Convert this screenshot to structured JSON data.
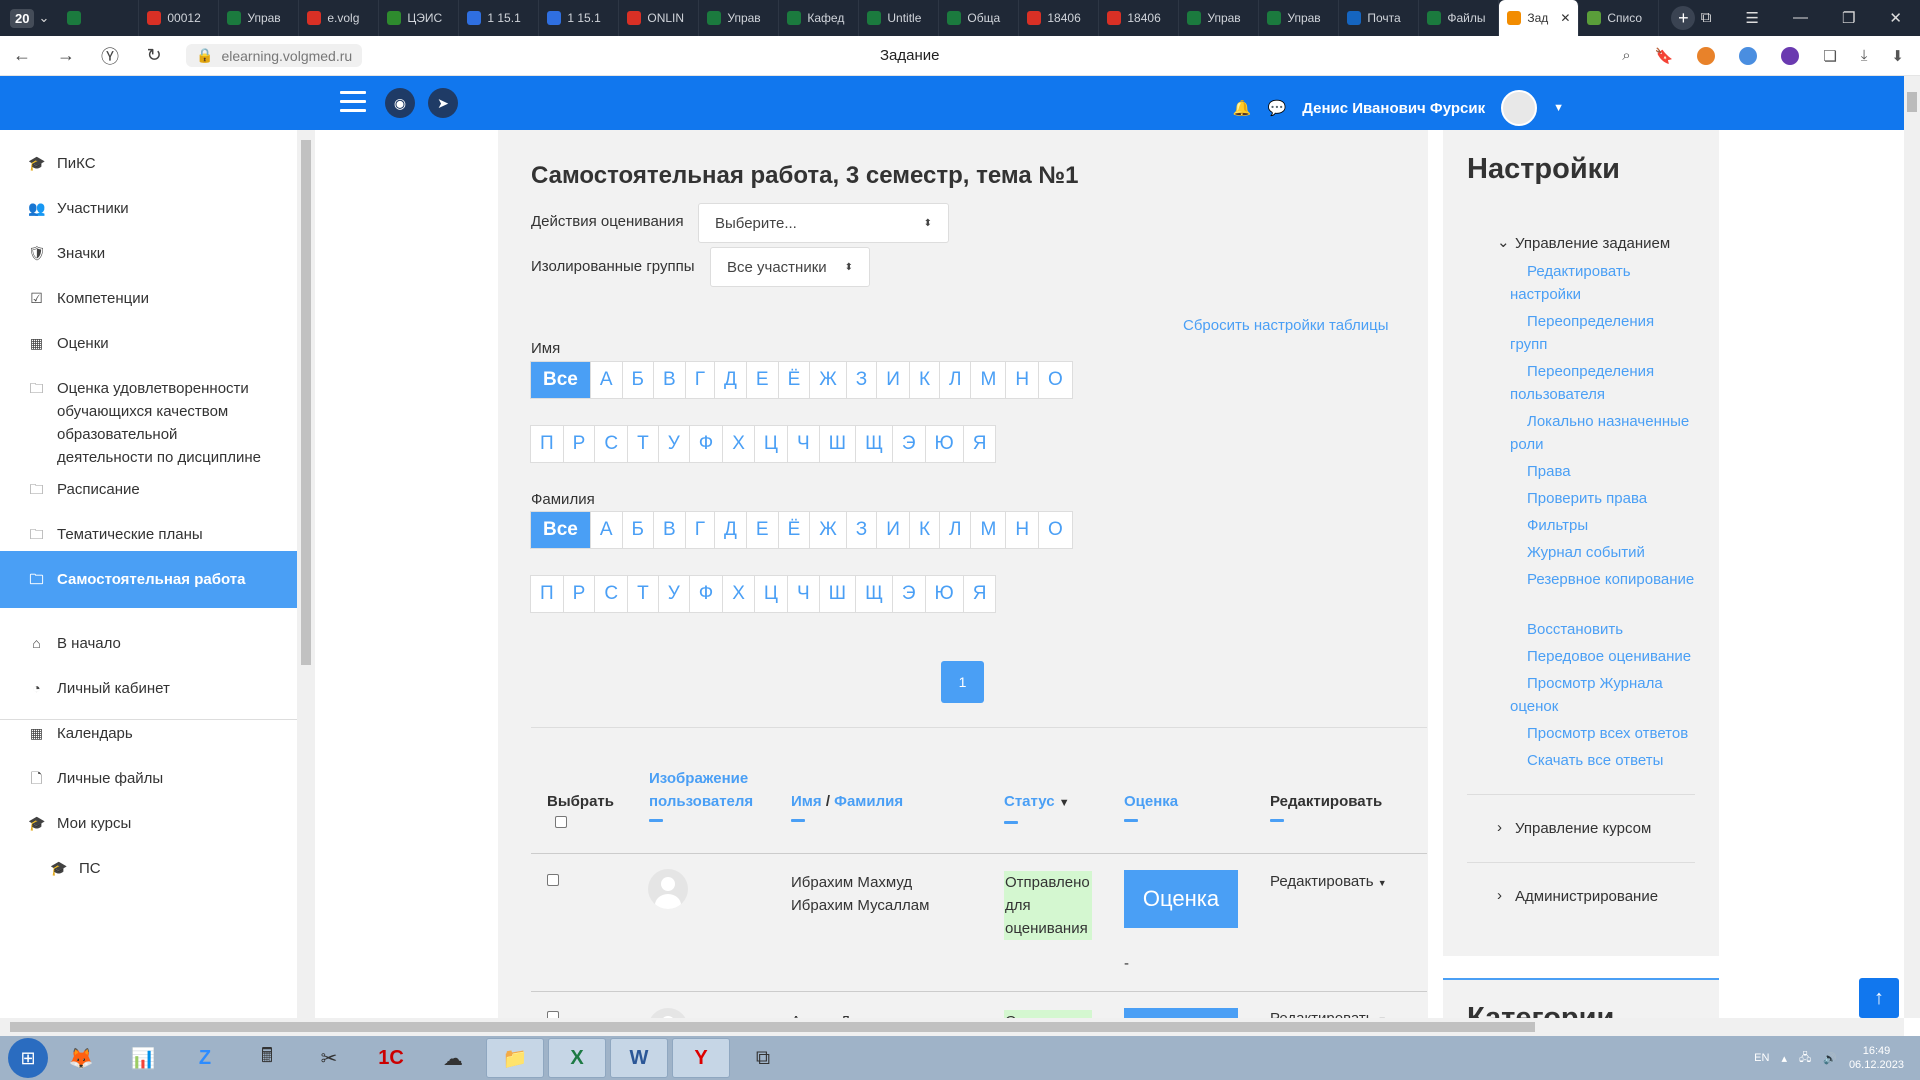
{
  "browser": {
    "tab_count": "20",
    "tabs": [
      {
        "label": "",
        "color": "#1b7a3e"
      },
      {
        "label": "00012",
        "color": "#d93025"
      },
      {
        "label": "Управ",
        "color": "#1b7a3e"
      },
      {
        "label": "e.volg",
        "color": "#d93025"
      },
      {
        "label": "ЦЭИС",
        "color": "#2e8b2e"
      },
      {
        "label": "1 15.1",
        "color": "#2f6fe0"
      },
      {
        "label": "1 15.1",
        "color": "#2f6fe0"
      },
      {
        "label": "ONLIN",
        "color": "#d93025"
      },
      {
        "label": "Управ",
        "color": "#1b7a3e"
      },
      {
        "label": "Кафед",
        "color": "#1b7a3e"
      },
      {
        "label": "Untitle",
        "color": "#1b7a3e"
      },
      {
        "label": "Обща",
        "color": "#1b7a3e"
      },
      {
        "label": "18406",
        "color": "#d93025"
      },
      {
        "label": "18406",
        "color": "#d93025"
      },
      {
        "label": "Управ",
        "color": "#1b7a3e"
      },
      {
        "label": "Управ",
        "color": "#1b7a3e"
      },
      {
        "label": "Почта",
        "color": "#1565c0"
      },
      {
        "label": "Файлы",
        "color": "#1b7a3e"
      },
      {
        "label": "Зад",
        "color": "#f28c00",
        "active": true
      },
      {
        "label": "Списо",
        "color": "#5a9e3a"
      }
    ],
    "url": "elearning.volgmed.ru",
    "page_title": "Задание"
  },
  "topnav": {
    "user_name": "Денис Иванович Фурсик"
  },
  "sidebar": {
    "items": [
      {
        "label": "ПиКС",
        "icon": "graduation-cap-icon",
        "glyph": "🎓"
      },
      {
        "label": "Участники",
        "icon": "users-icon",
        "glyph": "👥"
      },
      {
        "label": "Значки",
        "icon": "shield-icon",
        "glyph": "🛡"
      },
      {
        "label": "Компетенции",
        "icon": "checkbox-icon",
        "glyph": "☑"
      },
      {
        "label": "Оценки",
        "icon": "table-icon",
        "glyph": "▦"
      },
      {
        "label": "Оценка удовлетворенности обучающихся качеством образовательной деятельности по дисциплине",
        "icon": "folder-icon",
        "glyph": "🗀"
      },
      {
        "label": "Расписание",
        "icon": "folder-icon",
        "glyph": "🗀"
      },
      {
        "label": "Тематические планы",
        "icon": "folder-icon",
        "glyph": "🗀"
      },
      {
        "label": "Самостоятельная работа",
        "icon": "folder-icon",
        "glyph": "🗀",
        "active": true
      },
      {
        "label": "В начало",
        "icon": "home-icon",
        "glyph": "⌂"
      },
      {
        "label": "Личный кабинет",
        "icon": "dashboard-icon",
        "glyph": "◔"
      },
      {
        "label": "Календарь",
        "icon": "calendar-icon",
        "glyph": "▦"
      },
      {
        "label": "Личные файлы",
        "icon": "file-icon",
        "glyph": "🗋"
      },
      {
        "label": "Мои курсы",
        "icon": "graduation-cap-icon",
        "glyph": "🎓"
      },
      {
        "label": "ПС",
        "icon": "graduation-cap-icon",
        "glyph": "🎓"
      }
    ]
  },
  "main": {
    "title": "Самостоятельная работа, 3 семестр, тема №1",
    "grading_actions_label": "Действия оценивания",
    "grading_actions_value": "Выберите...",
    "groups_label": "Изолированные группы",
    "groups_value": "Все участники",
    "reset_link": "Сбросить настройки таблицы",
    "firstname_label": "Имя",
    "lastname_label": "Фамилия",
    "letters_row1": [
      "Все",
      "А",
      "Б",
      "В",
      "Г",
      "Д",
      "Е",
      "Ё",
      "Ж",
      "З",
      "И",
      "К",
      "Л",
      "М",
      "Н",
      "О"
    ],
    "letters_row2": [
      "П",
      "Р",
      "С",
      "Т",
      "У",
      "Ф",
      "Х",
      "Ц",
      "Ч",
      "Ш",
      "Щ",
      "Э",
      "Ю",
      "Я"
    ],
    "page": "1",
    "table": {
      "headers": {
        "select": "Выбрать",
        "picture": "Изображение пользователя",
        "name": "Имя",
        "name_sep": "/",
        "surname": "Фамилия",
        "status": "Статус",
        "grade": "Оценка",
        "edit": "Редактировать"
      },
      "rows": [
        {
          "name": "Ибрахим Махмуд Ибрахим Мусаллам",
          "status": "Отправлено для оценивания",
          "grade_button": "Оценка",
          "grade_value": "-",
          "edit": "Редактировать"
        },
        {
          "name": "Ахмад Джумах",
          "status": "Отправлено",
          "grade_button": "",
          "edit": "Редактировать"
        }
      ]
    }
  },
  "settings": {
    "title": "Настройки",
    "section": "Управление заданием",
    "links": [
      "Редактировать настройки",
      "Переопределения групп",
      "Переопределения пользователя",
      "Локально назначенные роли",
      "Права",
      "Проверить права",
      "Фильтры",
      "Журнал событий",
      "Резервное копирование",
      "Восстановить",
      "Передовое оценивание",
      "Просмотр Журнала оценок",
      "Просмотр всех ответов",
      "Скачать все ответы"
    ],
    "course_admin": "Управление курсом",
    "administration": "Администрирование",
    "categories_title": "Категории"
  },
  "taskbar": {
    "lang": "EN",
    "time": "16:49",
    "date": "06.12.2023"
  }
}
